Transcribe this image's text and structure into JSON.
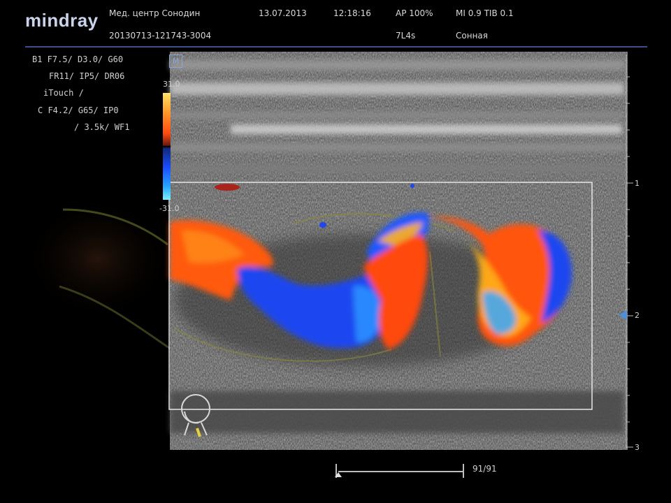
{
  "header": {
    "logo": "mindray",
    "institution": "Мед. центр Сонодин",
    "patient_id": "20130713-121743-3004",
    "date": "13.07.2013",
    "time": "12:18:16",
    "ap": "AP  100%",
    "mi_tib": "MI 0.9  TIB 0.1",
    "probe": "7L4s",
    "preset": "Сонная"
  },
  "params": {
    "row1": "B1  F7.5/   D3.0/    G60",
    "row2": "FR11/    IP5/   DR06",
    "row3": "iTouch    /",
    "row4": "C    F4.2/    G65/     IP0",
    "row5": "/   3.5k/   WF1"
  },
  "color_scale": {
    "top": "31.0",
    "bottom": "-31.0"
  },
  "mode_icon": "M",
  "depth": [
    "1",
    "2",
    "3"
  ],
  "cine": {
    "frames": "91/91"
  },
  "icons": [
    "body-mark-neck-icon",
    "focus-marker-icon",
    "cine-slider-icon"
  ],
  "colors": {
    "accent": "#3a4f8c",
    "doppler_red": "#ff4a10",
    "doppler_blue": "#1b4dff",
    "roi_box": "#e8e8e8"
  }
}
